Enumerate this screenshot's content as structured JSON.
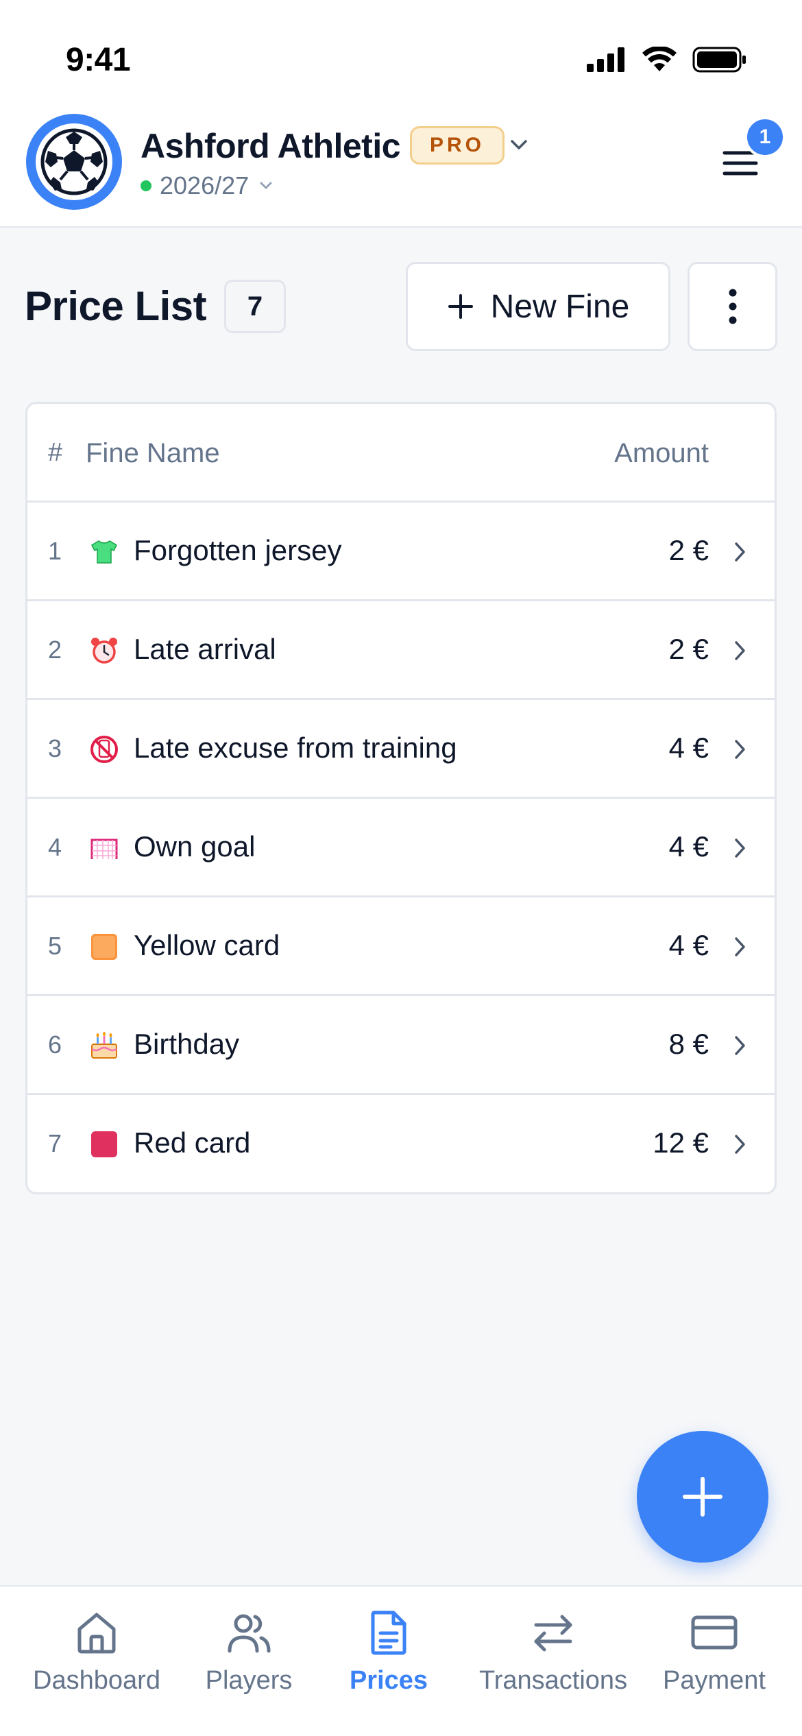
{
  "status_bar": {
    "time": "9:41"
  },
  "header": {
    "club_name": "Ashford Athletic",
    "plan_badge": "PRO",
    "season": "2026/27",
    "notification_count": "1"
  },
  "page": {
    "title": "Price List",
    "count": "7",
    "new_fine_label": "New Fine"
  },
  "table": {
    "columns": {
      "index": "#",
      "name": "Fine Name",
      "amount": "Amount"
    },
    "rows": [
      {
        "index": "1",
        "icon": "tshirt-icon",
        "name": "Forgotten jersey",
        "amount": "2 €"
      },
      {
        "index": "2",
        "icon": "alarm-clock-icon",
        "name": "Late arrival",
        "amount": "2 €"
      },
      {
        "index": "3",
        "icon": "no-phone-icon",
        "name": "Late excuse from training",
        "amount": "4 €"
      },
      {
        "index": "4",
        "icon": "goal-net-icon",
        "name": "Own goal",
        "amount": "4 €"
      },
      {
        "index": "5",
        "icon": "yellow-card-icon",
        "name": "Yellow card",
        "amount": "4 €"
      },
      {
        "index": "6",
        "icon": "birthday-cake-icon",
        "name": "Birthday",
        "amount": "8 €"
      },
      {
        "index": "7",
        "icon": "red-card-icon",
        "name": "Red card",
        "amount": "12 €"
      }
    ]
  },
  "bottom_nav": {
    "items": [
      {
        "label": "Dashboard",
        "icon": "home-icon",
        "active": false
      },
      {
        "label": "Players",
        "icon": "users-icon",
        "active": false
      },
      {
        "label": "Prices",
        "icon": "document-icon",
        "active": true
      },
      {
        "label": "Transactions",
        "icon": "swap-arrows-icon",
        "active": false
      },
      {
        "label": "Payment",
        "icon": "credit-card-icon",
        "active": false
      }
    ]
  },
  "colors": {
    "accent": "#3b82f6",
    "pro_badge_bg": "#fdf0d8",
    "pro_badge_text": "#b45309",
    "online_dot": "#22c55e"
  }
}
